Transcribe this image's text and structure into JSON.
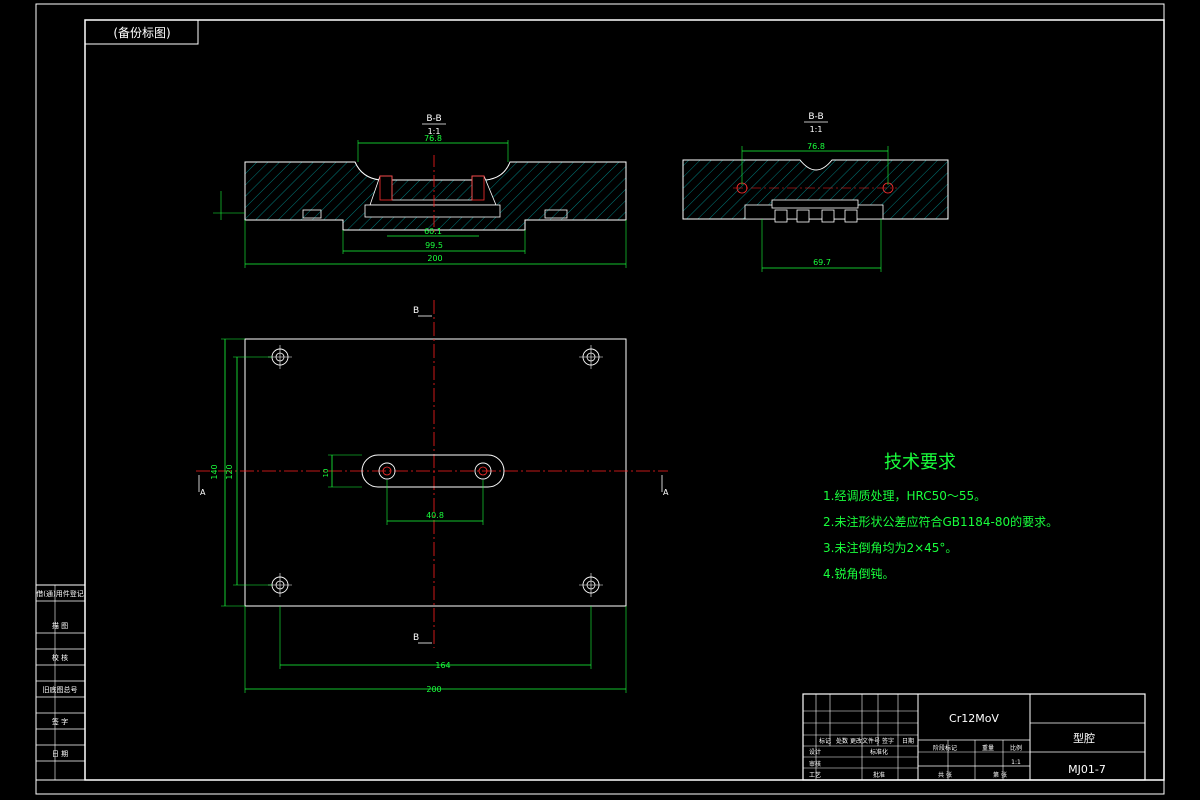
{
  "drawing": {
    "stamp": "(备份标图)",
    "material": "Cr12MoV",
    "part_name": "型腔",
    "drawing_no": "MJ01-7",
    "section_bb_label": "B-B",
    "section_bb_scale": "1:1",
    "section_aa_label": "B-B",
    "section_aa_scale": "1:1",
    "cut_mark_b": "B",
    "cut_mark_a": "A"
  },
  "dimensions": {
    "top_overall": "200",
    "top_inner1": "99.5",
    "top_inner2": "60.1",
    "top_cavity": "76.8",
    "side_top": "76.8",
    "side_bottom": "69.7",
    "plan_width": "200",
    "plan_hole_spacing": "164",
    "plan_height_outer": "140",
    "plan_height_inner": "120",
    "plan_slot_spacing": "40.8",
    "plan_slot_height": "10",
    "plan_left_small": "4"
  },
  "tech": {
    "title": "技术要求",
    "items": [
      "1.经调质处理，HRC50～55。",
      "2.未注形状公差应符合GB1184-80的要求。",
      "3.未注倒角均为2×45°。",
      "4.锐角倒钝。"
    ]
  },
  "left_table": {
    "rows": [
      "借(通)用件登记",
      "描 图",
      "校 核",
      "旧底图总号",
      "签 字",
      "日 期"
    ]
  },
  "title_block": {
    "row_labels": [
      "标记",
      "处数",
      "更改文件号",
      "签字",
      "日期"
    ],
    "design": "设计",
    "standard": "标准化",
    "check": "审核",
    "process": "工艺",
    "approve": "批准",
    "stage": "阶段标记",
    "weight": "重量",
    "scale_label": "比例",
    "scale_value": "1:1",
    "sheets": "共 张",
    "sheet": "第 张"
  },
  "colors": {
    "frame": "#ffffff",
    "outline": "#ffffff",
    "hatch": "#00e0e0",
    "dimension": "#19ff3c",
    "centerline": "#ff2020",
    "tech_text": "#19ff3c"
  }
}
